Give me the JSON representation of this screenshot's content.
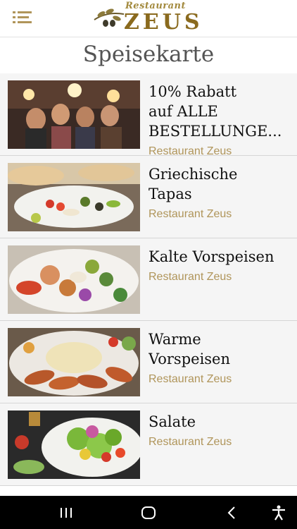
{
  "header": {
    "logo_top": "Restaurant",
    "logo_main": "ZEUS"
  },
  "page": {
    "title": "Speisekarte"
  },
  "items": [
    {
      "title": "10% Rabatt\nauf ALLE\nBESTELLUNGE...",
      "subtitle": "Restaurant Zeus"
    },
    {
      "title": "Griechische\nTapas",
      "subtitle": "Restaurant Zeus"
    },
    {
      "title": "Kalte Vorspeisen",
      "subtitle": "Restaurant Zeus"
    },
    {
      "title": "Warme\nVorspeisen",
      "subtitle": "Restaurant Zeus"
    },
    {
      "title": "Salate",
      "subtitle": "Restaurant Zeus"
    }
  ],
  "colors": {
    "accent": "#b0955a",
    "logo": "#8a6a1e"
  }
}
